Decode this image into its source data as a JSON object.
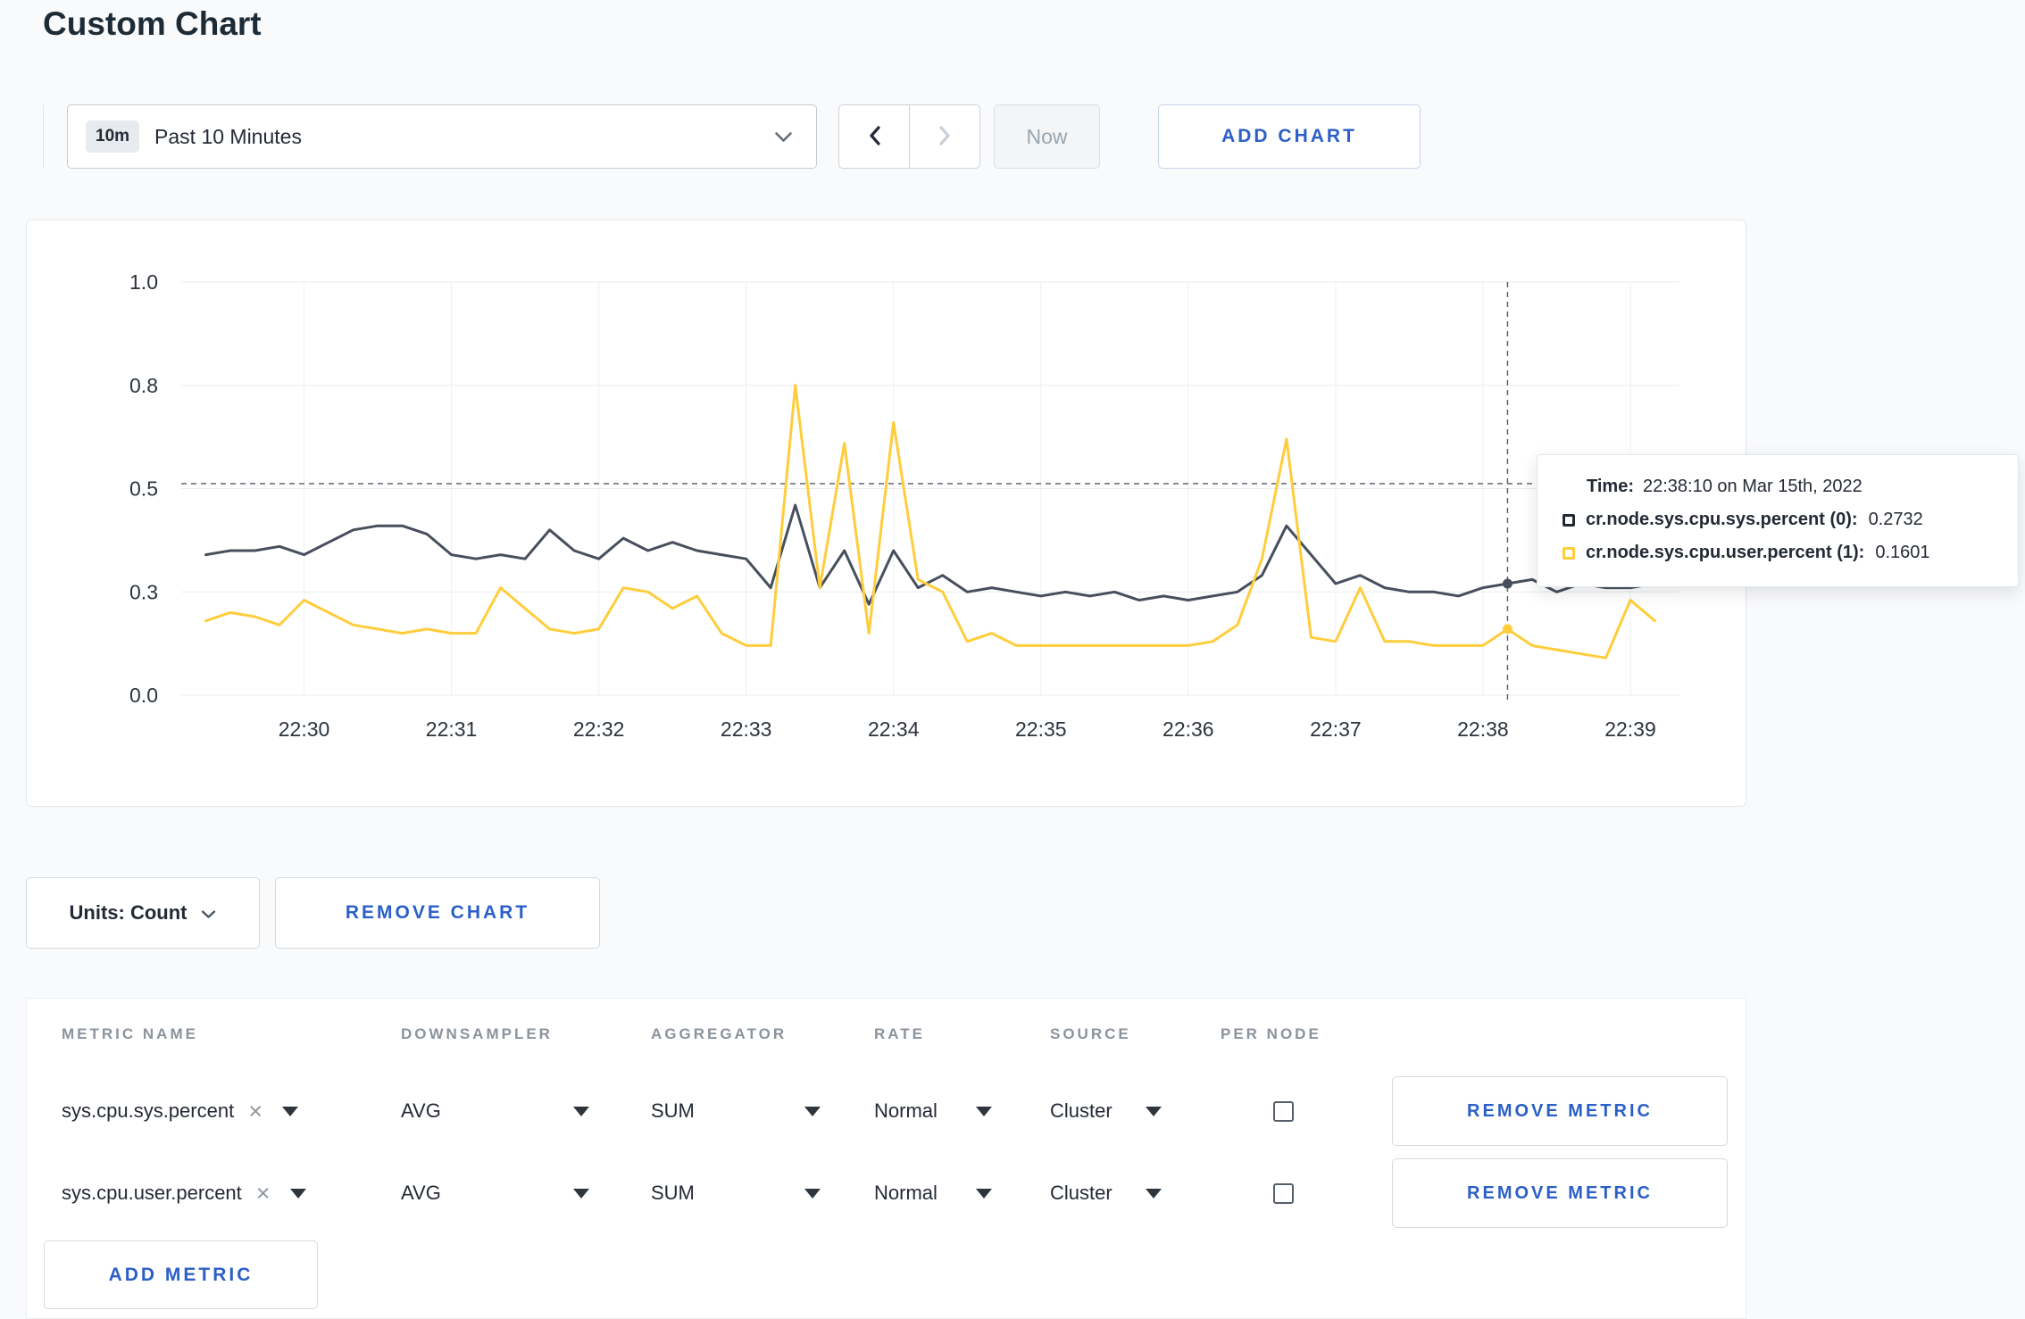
{
  "page": {
    "title": "Custom Chart"
  },
  "colors": {
    "accent": "#2b5fc7",
    "grid": "#e8ebee",
    "axis_text": "#2b333c"
  },
  "icons": {
    "close": "×"
  },
  "toolbar": {
    "range_badge": "10m",
    "range_label": "Past 10 Minutes",
    "now_label": "Now",
    "add_chart_label": "ADD CHART"
  },
  "chart_data": {
    "type": "line",
    "title": "",
    "xlabel": "",
    "ylabel": "",
    "ylim": [
      0,
      1
    ],
    "y_ticks": [
      {
        "v": 0,
        "label": "0.0"
      },
      {
        "v": 0.25,
        "label": "0.3"
      },
      {
        "v": 0.5,
        "label": "0.5"
      },
      {
        "v": 0.75,
        "label": "0.8"
      },
      {
        "v": 1,
        "label": "1.0"
      }
    ],
    "x_domain_seconds": [
      -50,
      560
    ],
    "x_ticks": [
      {
        "t": 0,
        "label": "22:30"
      },
      {
        "t": 60,
        "label": "22:31"
      },
      {
        "t": 120,
        "label": "22:32"
      },
      {
        "t": 180,
        "label": "22:33"
      },
      {
        "t": 240,
        "label": "22:34"
      },
      {
        "t": 300,
        "label": "22:35"
      },
      {
        "t": 360,
        "label": "22:36"
      },
      {
        "t": 420,
        "label": "22:37"
      },
      {
        "t": 480,
        "label": "22:38"
      },
      {
        "t": 540,
        "label": "22:39"
      }
    ],
    "x_start": -40,
    "x_step": 10,
    "series": [
      {
        "name": "cr.node.sys.cpu.sys.percent",
        "color": "#474f5c",
        "values": [
          0.34,
          0.35,
          0.35,
          0.36,
          0.34,
          0.37,
          0.4,
          0.41,
          0.41,
          0.39,
          0.34,
          0.33,
          0.34,
          0.33,
          0.4,
          0.35,
          0.33,
          0.38,
          0.35,
          0.37,
          0.35,
          0.34,
          0.33,
          0.26,
          0.46,
          0.26,
          0.35,
          0.22,
          0.35,
          0.26,
          0.29,
          0.25,
          0.26,
          0.25,
          0.24,
          0.25,
          0.24,
          0.25,
          0.23,
          0.24,
          0.23,
          0.24,
          0.25,
          0.29,
          0.41,
          0.34,
          0.27,
          0.29,
          0.26,
          0.25,
          0.25,
          0.24,
          0.26,
          0.27,
          0.28,
          0.25,
          0.27,
          0.26,
          0.26,
          0.27
        ]
      },
      {
        "name": "cr.node.sys.cpu.user.percent",
        "color": "#ffcd3c",
        "values": [
          0.18,
          0.2,
          0.19,
          0.17,
          0.23,
          0.2,
          0.17,
          0.16,
          0.15,
          0.16,
          0.15,
          0.15,
          0.26,
          0.21,
          0.16,
          0.15,
          0.16,
          0.26,
          0.25,
          0.21,
          0.24,
          0.15,
          0.12,
          0.12,
          0.75,
          0.26,
          0.61,
          0.15,
          0.66,
          0.28,
          0.25,
          0.13,
          0.15,
          0.12,
          0.12,
          0.12,
          0.12,
          0.12,
          0.12,
          0.12,
          0.12,
          0.13,
          0.17,
          0.33,
          0.62,
          0.14,
          0.13,
          0.26,
          0.13,
          0.13,
          0.12,
          0.12,
          0.12,
          0.16,
          0.12,
          0.11,
          0.1,
          0.09,
          0.23,
          0.18
        ]
      }
    ],
    "guide_line_y": 0.512,
    "crosshair_t": 490,
    "marker_values": [
      0.27,
      0.16
    ],
    "legend_position": "tooltip",
    "grid": true
  },
  "tooltip": {
    "time_label": "Time:",
    "time_value": "22:38:10 on Mar 15th, 2022",
    "rows": [
      {
        "name": "cr.node.sys.cpu.sys.percent (0):",
        "value": "0.2732",
        "color": "#242a35"
      },
      {
        "name": "cr.node.sys.cpu.user.percent (1):",
        "value": "0.1601",
        "color": "#ffcd3c"
      }
    ]
  },
  "chart_footer": {
    "units_label": "Units: Count",
    "remove_chart_label": "REMOVE CHART"
  },
  "metrics_table": {
    "headers": [
      "METRIC NAME",
      "DOWNSAMPLER",
      "AGGREGATOR",
      "RATE",
      "SOURCE",
      "PER NODE"
    ],
    "rows": [
      {
        "name": "sys.cpu.sys.percent",
        "downsampler": "AVG",
        "aggregator": "SUM",
        "rate": "Normal",
        "source": "Cluster",
        "per_node": false,
        "remove_label": "REMOVE METRIC"
      },
      {
        "name": "sys.cpu.user.percent",
        "downsampler": "AVG",
        "aggregator": "SUM",
        "rate": "Normal",
        "source": "Cluster",
        "per_node": false,
        "remove_label": "REMOVE METRIC"
      }
    ],
    "add_metric_label": "ADD METRIC"
  }
}
